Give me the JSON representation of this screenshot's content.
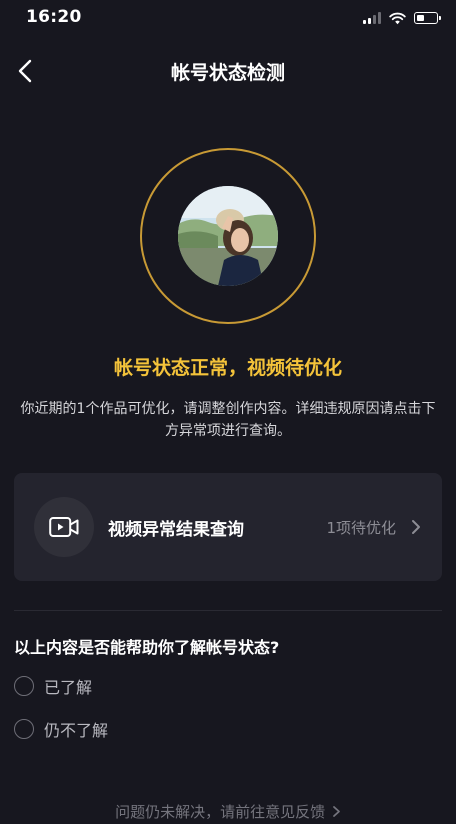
{
  "status_bar": {
    "time": "16:20"
  },
  "nav": {
    "title": "帐号状态检测"
  },
  "account_status": {
    "headline": "帐号状态正常，视频待优化",
    "description": "你近期的1个作品可优化，请调整创作内容。详细违规原因请点击下方异常项进行查询。"
  },
  "query_card": {
    "icon": "video-camera-icon",
    "title": "视频异常结果查询",
    "status": "1项待优化"
  },
  "feedback": {
    "question": "以上内容是否能帮助你了解帐号状态?",
    "options": [
      {
        "label": "已了解"
      },
      {
        "label": "仍不了解"
      }
    ]
  },
  "footer": {
    "link_text": "问题仍未解决，请前往意见反馈"
  },
  "colors": {
    "background": "#17171f",
    "card": "#24242e",
    "accent_gold": "#f4c33a",
    "ring_gold": "#c89a35"
  }
}
